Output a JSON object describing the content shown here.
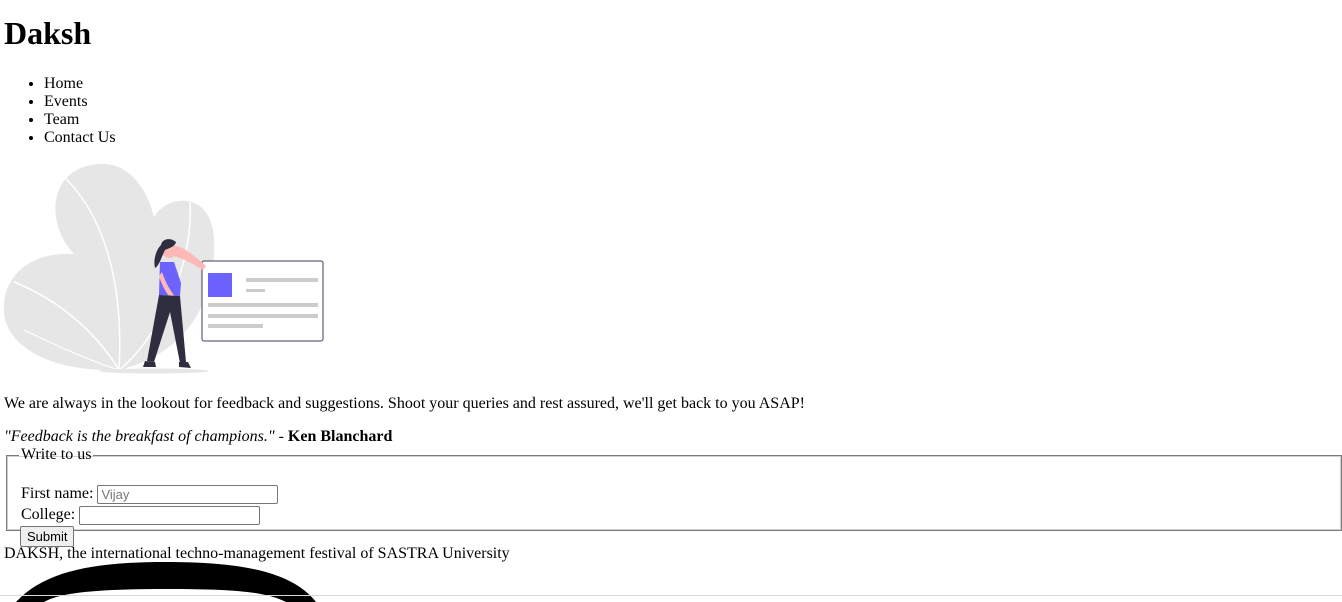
{
  "header": {
    "title": "Daksh"
  },
  "nav": {
    "items": [
      {
        "label": "Home"
      },
      {
        "label": "Events"
      },
      {
        "label": "Team"
      },
      {
        "label": "Contact Us"
      }
    ]
  },
  "hero": {
    "icon": "woman-presenting-card-illustration",
    "accent_color": "#6c63ff"
  },
  "intro": {
    "text": "We are always in the lookout for feedback and suggestions. Shoot your queries and rest assured, we'll get back to you ASAP!"
  },
  "quote": {
    "text": "\"Feedback is the breakfast of champions.\"",
    "separator": " - ",
    "author": "Ken Blanchard"
  },
  "form": {
    "legend": "Write to us",
    "first_name_label": "First name:",
    "first_name_placeholder": "Vijay",
    "first_name_value": "",
    "college_label": "College:",
    "college_placeholder": "",
    "college_value": "",
    "submit_label": "Submit"
  },
  "footer": {
    "text": "DAKSH, the international techno-management festival of SASTRA University",
    "logo_icon": "daksh-logo-icon"
  }
}
